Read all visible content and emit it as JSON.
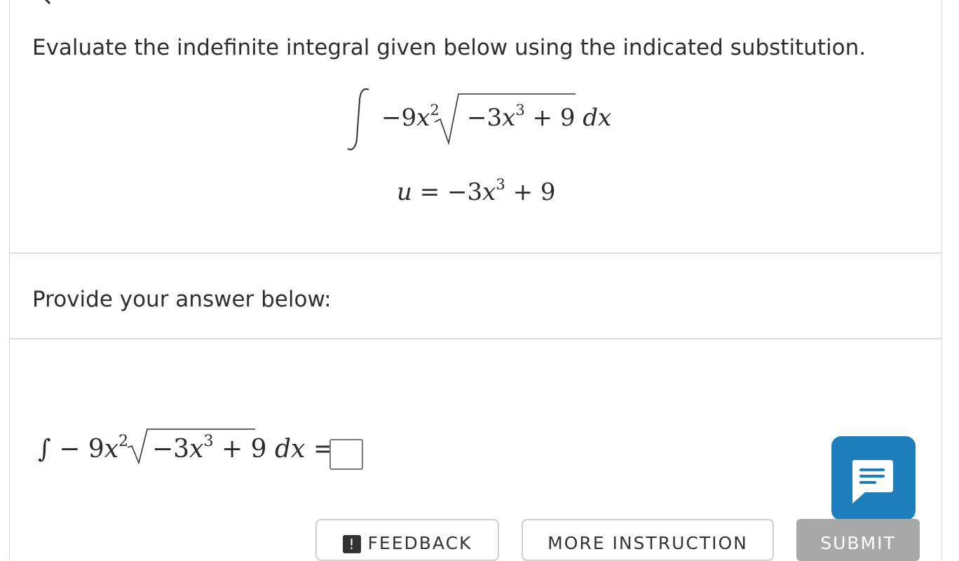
{
  "problem": {
    "instruction": "Evaluate the indefinite integral given below using the indicated substitution.",
    "integral_sign": "∫",
    "coef": "−9",
    "var": "x",
    "coef_exp": "2",
    "radicand_coef": "−3",
    "radicand_var": "x",
    "radicand_exp": "3",
    "radicand_const": "+ 9",
    "differential": "dx",
    "sub_u": "u",
    "sub_eq": "=",
    "sub_coef": "−3",
    "sub_var": "x",
    "sub_exp": "3",
    "sub_const": "+ 9"
  },
  "answer": {
    "prompt": "Provide your answer below:",
    "integral_sign": "∫",
    "coef": "− 9",
    "var": "x",
    "coef_exp": "2",
    "radicand_coef": "−3",
    "radicand_var": "x",
    "radicand_exp": "3",
    "radicand_const": "+ 9",
    "differential": "dx",
    "equals": "="
  },
  "buttons": {
    "feedback_label": "FEEDBACK",
    "feedback_icon": "!",
    "more_instruction_label": "MORE INSTRUCTION",
    "submit_label": "SUBMIT"
  },
  "colors": {
    "chat_button": "#1f7fbd",
    "submit_button": "#a8a8a8"
  }
}
